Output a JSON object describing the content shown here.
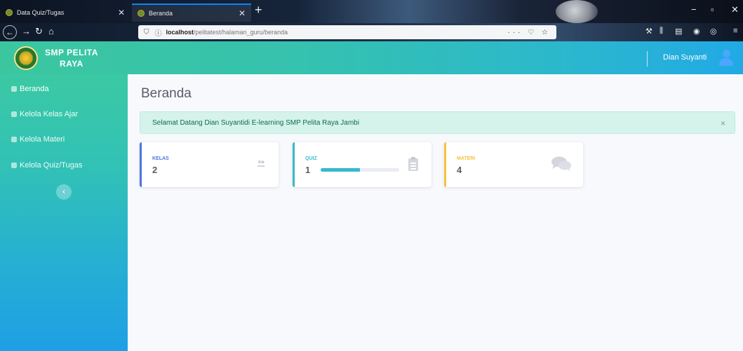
{
  "browser": {
    "tabs": [
      {
        "label": "Data Quiz/Tugas",
        "active": false
      },
      {
        "label": "Beranda",
        "active": true
      }
    ],
    "url_host": "localhost",
    "url_path": "/pelitatest/halaman_guru/beranda",
    "url_actions": "··· ♡ ☆"
  },
  "app": {
    "brand_line1": "SMP PELITA",
    "brand_line2": "RAYA",
    "user_name": "Dian Suyanti"
  },
  "sidebar": {
    "items": [
      {
        "label": "Beranda",
        "icon": "home-icon",
        "active": true
      },
      {
        "label": "Kelola Kelas Ajar",
        "icon": "user-icon"
      },
      {
        "label": "Kelola Materi",
        "icon": "user-icon"
      },
      {
        "label": "Kelola Quiz/Tugas",
        "icon": "user-icon"
      }
    ],
    "collapse_label": "‹"
  },
  "main": {
    "title": "Beranda",
    "alert": "Selamat Datang Dian Suyantidi E-learning SMP Pelita Raya Jambi",
    "alert_close": "×",
    "cards": [
      {
        "label": "KELAS",
        "value": "2",
        "color": "#4e73df",
        "icon": "users-icon"
      },
      {
        "label": "QUIZ",
        "value": "1",
        "color": "#36b9cc",
        "icon": "clipboard-icon",
        "progress": 0.5
      },
      {
        "label": "MATERI",
        "value": "4",
        "color": "#f6c23e",
        "icon": "comments-icon"
      }
    ]
  },
  "colors": {
    "primary": "#4e73df",
    "info": "#36b9cc",
    "warning": "#f6c23e",
    "success_gradient_start": "#3cc6a0",
    "success_gradient_end": "#21a9e6"
  }
}
